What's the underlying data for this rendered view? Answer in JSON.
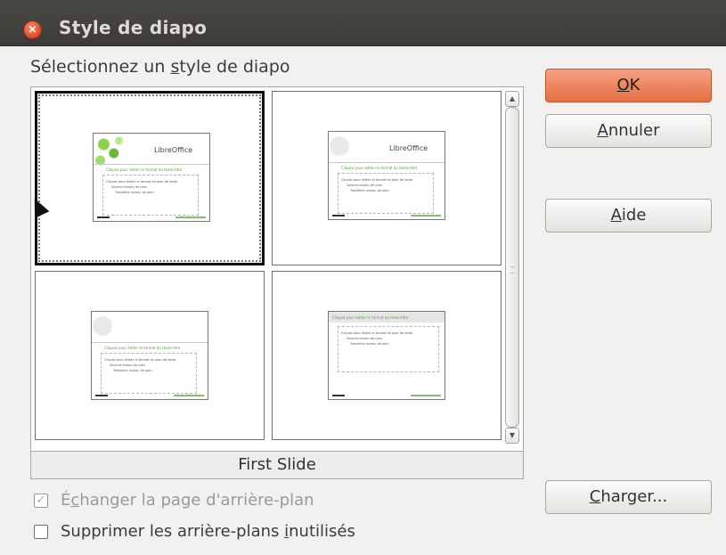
{
  "window": {
    "title": "Style de diapo",
    "close_glyph": "×"
  },
  "heading": {
    "pre": "Sélectionnez un ",
    "mnemonic": "s",
    "post": "tyle de diapo"
  },
  "slides": [
    {
      "title": "Cliquez pour éditer le format du texte-titre",
      "body1": "Cliquez pour éditer le format du plan de texte",
      "body2": "Second niveau de plan",
      "body3": "Troisième niveau de plan",
      "logo": "LibreOffice",
      "selected": true
    },
    {
      "title": "Cliquez pour éditer le format du texte-titre",
      "body1": "Cliquez pour éditer le format du plan de texte",
      "body2": "Second niveau de plan",
      "body3": "Troisième niveau de plan",
      "logo": "LibreOffice",
      "selected": false
    },
    {
      "title": "Cliquez pour éditer le format du texte-titre",
      "body1": "Cliquez pour éditer le format du plan de texte",
      "body2": "Second niveau de plan",
      "body3": "Troisième niveau de plan",
      "logo": "",
      "selected": false
    },
    {
      "title": "Cliquez pour éditer le format du texte-titre",
      "body1": "Cliquez pour éditer le format du plan de texte",
      "body2": "Second niveau de plan",
      "body3": "Troisième niveau de plan",
      "logo": "",
      "selected": false
    }
  ],
  "caption": "First Slide",
  "buttons": {
    "ok": {
      "mnemonic": "O",
      "rest": "K"
    },
    "cancel": {
      "mnemonic": "A",
      "rest": "nnuler"
    },
    "help": {
      "mnemonic": "A",
      "rest": "ide"
    },
    "load": {
      "mnemonic": "C",
      "rest": "harger..."
    }
  },
  "checkboxes": {
    "exchange": {
      "pre": "É",
      "mnemonic": "c",
      "post": "hanger la page d'arrière-plan",
      "checked": true,
      "disabled": true
    },
    "delete": {
      "pre": "Supprimer les arrière-plans ",
      "mnemonic": "i",
      "post": "nutilisés",
      "checked": false,
      "disabled": false
    }
  },
  "colors": {
    "titlebar": "#3c3b37",
    "accent_button": "#e66f43",
    "slide_title_green": "#4ca63a"
  },
  "icons": {
    "close": "close-icon",
    "scroll_up": "chevron-up-icon",
    "scroll_down": "chevron-down-icon",
    "check": "checkmark-icon"
  }
}
